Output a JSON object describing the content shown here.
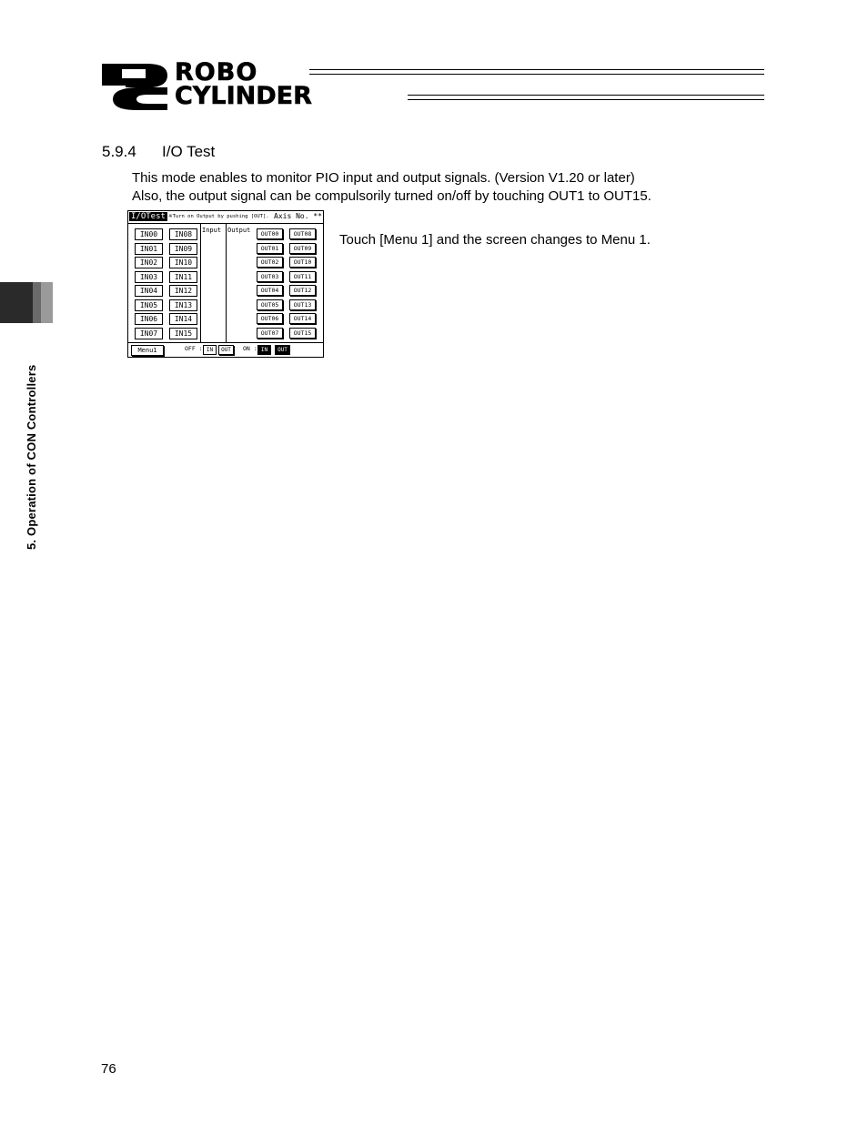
{
  "header": {
    "logo_word1": "ROBO",
    "logo_word2": "CYLINDER"
  },
  "side_tab": {
    "label": "5. Operation of CON Controllers"
  },
  "section": {
    "number": "5.9.4",
    "title": "I/O Test"
  },
  "body": {
    "line1": "This mode enables to monitor PIO input and output signals. (Version V1.20 or later)",
    "line2": "Also, the output signal can be compulsorily turned on/off by touching OUT1 to OUT15."
  },
  "screen": {
    "title": "I/OTest",
    "note": "※Turn on Output by pushing [OUT].",
    "axis": "Axis No. **",
    "input_label": "Input",
    "output_label": "Output",
    "inputs_col1": [
      "IN00",
      "IN01",
      "IN02",
      "IN03",
      "IN04",
      "IN05",
      "IN06",
      "IN07"
    ],
    "inputs_col2": [
      "IN08",
      "IN09",
      "IN10",
      "IN11",
      "IN12",
      "IN13",
      "IN14",
      "IN15"
    ],
    "outputs_col1": [
      "OUT00",
      "OUT01",
      "OUT02",
      "OUT03",
      "OUT04",
      "OUT05",
      "OUT06",
      "OUT07"
    ],
    "outputs_col2": [
      "OUT08",
      "OUT09",
      "OUT10",
      "OUT11",
      "OUT12",
      "OUT13",
      "OUT14",
      "OUT15"
    ],
    "menu_button": "Menu1",
    "legend_off": "OFF :",
    "legend_on": "ON :",
    "legend_in": "IN",
    "legend_out": "OUT"
  },
  "caption": "Touch [Menu 1] and the screen changes to Menu 1.",
  "page_number": "76"
}
